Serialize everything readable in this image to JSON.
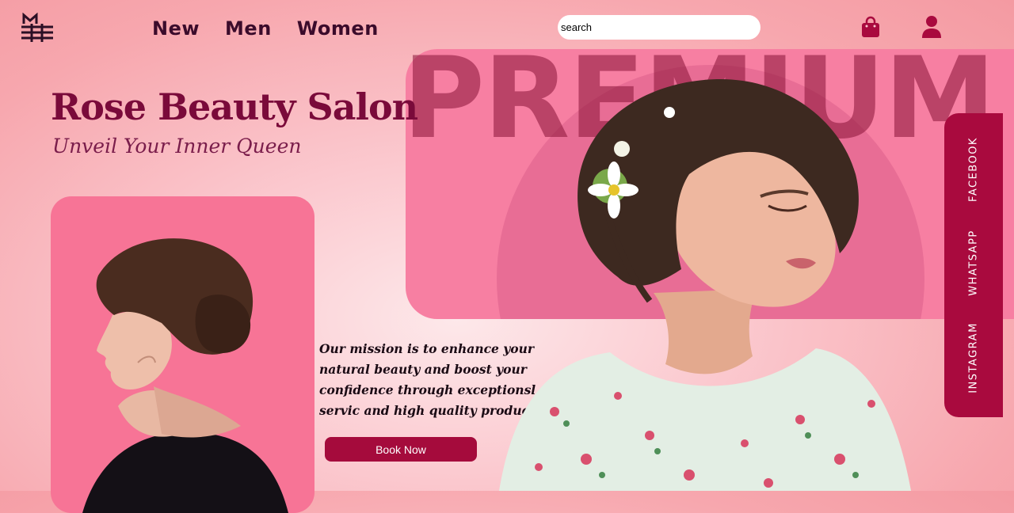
{
  "header": {
    "nav": [
      "New",
      "Men",
      "Women"
    ],
    "search_placeholder": "search"
  },
  "hero": {
    "watermark": "PREMIUM",
    "title": "Rose Beauty Salon",
    "tagline": "Unveil Your Inner Queen",
    "mission": "Our mission is to enhance your natural beauty and boost your confidence through exceptionsl servic and high quality products.",
    "cta": "Book Now"
  },
  "social": [
    "FACEBOOK",
    "WHATSAPP",
    "INSTAGRAM"
  ],
  "colors": {
    "accent": "#a50b3c",
    "panel_pink": "#f77fa2",
    "title": "#7a0a3a",
    "nav": "#3b0b2b"
  },
  "icons": [
    "logo-icon",
    "shopping-bag-icon",
    "user-icon"
  ]
}
